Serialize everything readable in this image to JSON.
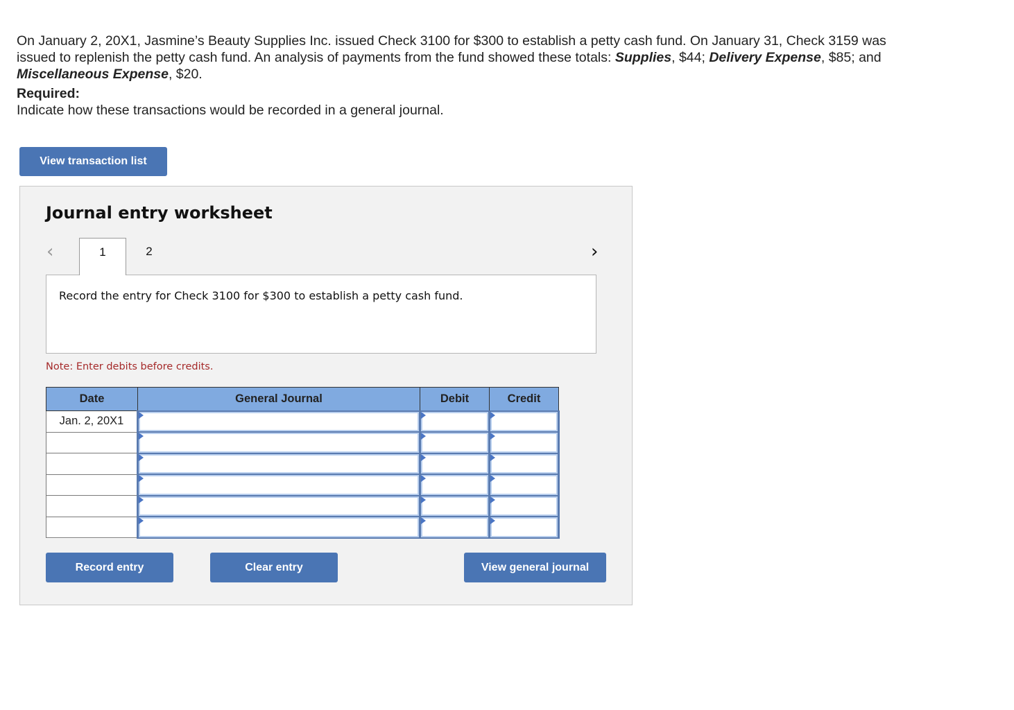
{
  "problem": {
    "segments": [
      {
        "text": "On January 2, 20X1, Jasmine’s Beauty Supplies Inc. issued Check 3100 for $300 to establish a petty cash fund. On January 31, Check 3159 was issued to replenish the petty cash fund. An analysis of payments from the fund showed these totals: ",
        "bold": false
      },
      {
        "text": "Supplies",
        "bold": true
      },
      {
        "text": ", $44; ",
        "bold": false
      },
      {
        "text": "Delivery Expense",
        "bold": true
      },
      {
        "text": ", $85; and ",
        "bold": false
      },
      {
        "text": "Miscellaneous Expense",
        "bold": true
      },
      {
        "text": ", $20.",
        "bold": false
      }
    ]
  },
  "required": {
    "label": "Required:",
    "text": "Indicate how these transactions would be recorded in a general journal."
  },
  "buttons": {
    "view_transaction_list": "View transaction list",
    "record_entry": "Record entry",
    "clear_entry": "Clear entry",
    "view_general_journal": "View general journal"
  },
  "worksheet": {
    "title": "Journal entry worksheet",
    "nav_prev_icon": "‹",
    "nav_next_icon": "›",
    "tabs": [
      {
        "label": "1",
        "active": true
      },
      {
        "label": "2",
        "active": false
      }
    ],
    "instruction": "Record the entry for Check 3100 for $300 to establish a petty cash fund.",
    "note": "Note: Enter debits before credits.",
    "table": {
      "headers": {
        "date": "Date",
        "account": "General Journal",
        "debit": "Debit",
        "credit": "Credit"
      },
      "rows": [
        {
          "date": "Jan. 2, 20X1",
          "account": "",
          "debit": "",
          "credit": ""
        },
        {
          "date": "",
          "account": "",
          "debit": "",
          "credit": ""
        },
        {
          "date": "",
          "account": "",
          "debit": "",
          "credit": ""
        },
        {
          "date": "",
          "account": "",
          "debit": "",
          "credit": ""
        },
        {
          "date": "",
          "account": "",
          "debit": "",
          "credit": ""
        },
        {
          "date": "",
          "account": "",
          "debit": "",
          "credit": ""
        }
      ]
    }
  },
  "colors": {
    "button_bg": "#4a75b4",
    "header_bg": "#80aae0",
    "note_text": "#a52a2a",
    "worksheet_bg": "#f2f2f2"
  }
}
